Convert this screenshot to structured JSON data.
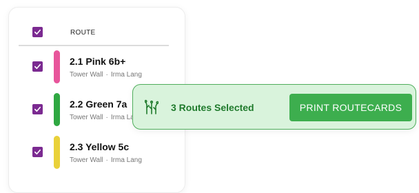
{
  "table": {
    "column_header": "ROUTE",
    "header_checked": true,
    "rows": [
      {
        "title": "2.1 Pink 6b+",
        "wall": "Tower Wall",
        "setter": "Irma Lang",
        "color": "#e8559b",
        "checked": true
      },
      {
        "title": "2.2 Green 7a",
        "wall": "Tower Wall",
        "setter": "Irma Lang",
        "color": "#2fa842",
        "checked": true
      },
      {
        "title": "2.3 Yellow 5c",
        "wall": "Tower Wall",
        "setter": "Irma Lang",
        "color": "#e9d13a",
        "checked": true
      }
    ],
    "separator": "·"
  },
  "selection_bar": {
    "icon": "routes-icon",
    "text": "3 Routes Selected",
    "button_label": "PRINT ROUTECARDS"
  },
  "colors": {
    "checkbox": "#7b2a91",
    "accent_green": "#3dae4e",
    "toast_bg": "#d9f3dc"
  }
}
